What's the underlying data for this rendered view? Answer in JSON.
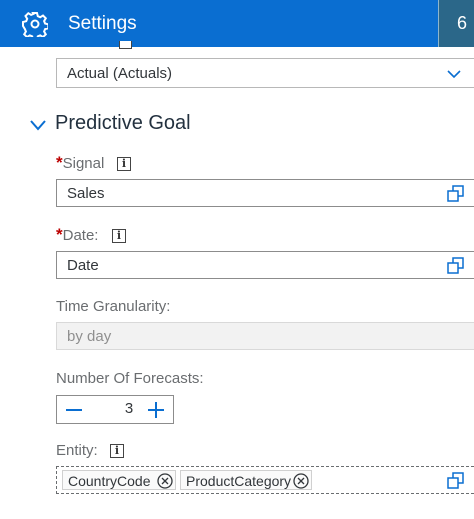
{
  "header": {
    "title": "Settings",
    "right_button_glyph": "6"
  },
  "version_select": {
    "value": "Actual (Actuals)",
    "icon": "chevron-down-icon"
  },
  "predictive_goal": {
    "title": "Predictive Goal",
    "signal": {
      "required_mark": "*",
      "label": "Signal",
      "value": "Sales"
    },
    "date": {
      "required_mark": "*",
      "label": "Date:",
      "value": "Date"
    },
    "time_granularity": {
      "label": "Time Granularity:",
      "value": "by day"
    },
    "number_of_forecasts": {
      "label": "Number Of Forecasts:",
      "value": "3"
    },
    "entity": {
      "label": "Entity:",
      "tokens": [
        "CountryCode",
        "ProductCategory"
      ]
    }
  },
  "colors": {
    "header_bg": "#0a6ed1",
    "accent": "#0a6ed1",
    "required": "#bb0000"
  }
}
